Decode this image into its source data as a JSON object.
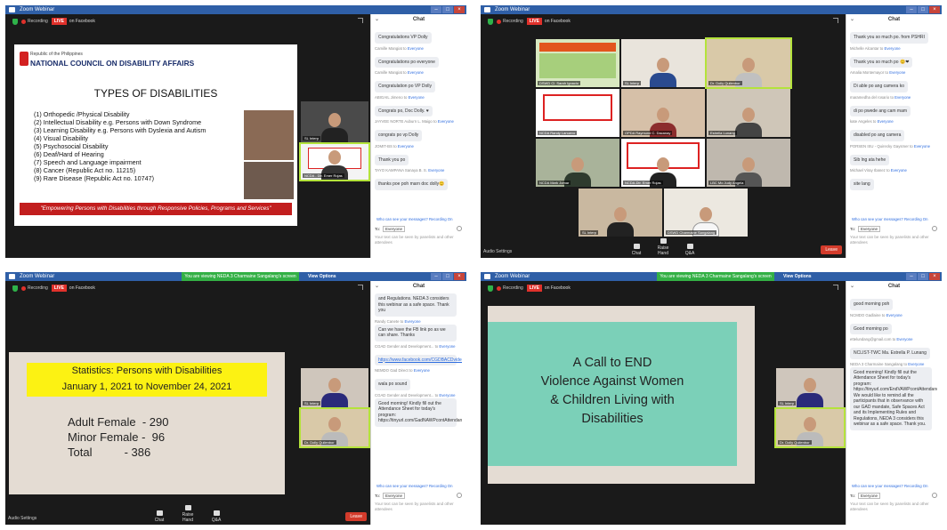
{
  "common": {
    "window_title": "Zoom Webinar",
    "recording": "Recording",
    "live": "LIVE",
    "on_facebook": "on Facebook",
    "chat_title": "Chat",
    "who_can_see": "Who can see your messages? Recording On",
    "to_label": "To:",
    "to_value": "Everyone",
    "chat_note": "Your text can be seen by panelists and other attendees",
    "audio_settings": "Audio Settings",
    "chat_btn": "Chat",
    "raise_hand": "Raise Hand",
    "qa": "Q&A",
    "leave": "Leave",
    "viewing": "You are viewing NEDA 3 Charmaine Sangalang's screen",
    "view_options": "View Options"
  },
  "q1": {
    "slide": {
      "republic": "Republic of the Philippines",
      "org": "NATIONAL COUNCIL ON DISABILITY AFFAIRS",
      "title": "TYPES OF DISABILITIES",
      "items": [
        "(1) Orthopedic /Physical Disability",
        "(2) Intellectual Disability e.g. Persons with Down Syndrome",
        "(3) Learning Disability e.g. Persons with Dyslexia and Autism",
        "(4) Visual Disability",
        "(5) Psychosocial Disability",
        "(6) Deaf/Hard of Hearing",
        "(7) Speech and Language impairment",
        "(8) Cancer (Republic Act no. 11215)",
        "(9) Rare Disease (Republic Act no. 10747)"
      ],
      "footer": "\"Empowering Persons with Disabilities through Responsive Policies, Programs and Services\""
    },
    "tiles": [
      {
        "name": "SL Interp"
      },
      {
        "name": "NCDA - Dir. Emer Rojas"
      }
    ],
    "messages": [
      {
        "from": "",
        "to": "",
        "text": "Congratulations VP Dolly"
      },
      {
        "from": "Camille Mangiat to",
        "to": "Everyone",
        "text": "Congratulations po everyone"
      },
      {
        "from": "Camille Mangiat to",
        "to": "Everyone",
        "text": "Congratulation po VP Dolly"
      },
      {
        "from": "ABIGAIL Jimeno to",
        "to": "Everyone",
        "text": "Congrats po, Doc Dolly. ♥"
      },
      {
        "from": "JAYVEE NORTE Auburn L. Maigo to",
        "to": "Everyone",
        "text": "congrats po vp Dolly"
      },
      {
        "from": "JOMIT-BS to",
        "to": "Everyone",
        "text": "Thank you po"
      },
      {
        "from": "TAYO KAMPANA Sanaya B. S.",
        "to": "Everyone",
        "text": "thanks poe poh marn doc dolly😊"
      }
    ]
  },
  "q2": {
    "tiles": [
      {
        "name": "DSWD Cl. Sarah Ignacio"
      },
      {
        "name": "SL Interp"
      },
      {
        "name": "Dr. Dolly Quilenbor"
      },
      {
        "name": "NCDA Randy Lanuevo"
      },
      {
        "name": "OPDA Raymund C. Dacanay"
      },
      {
        "name": "Estrella Lunang"
      },
      {
        "name": "NCDA Mark Jomar"
      },
      {
        "name": "NCDA-Dir. Emer Rojas"
      },
      {
        "name": "LBC Mo Judy Angela"
      },
      {
        "name": "SL Interp"
      },
      {
        "name": "DSWD Charmaine Sangalang"
      }
    ],
    "messages": [
      {
        "from": "",
        "to": "",
        "text": "Thank you so much po. from PSHRI"
      },
      {
        "from": "Michelle Alcantar to",
        "to": "Everyone",
        "text": "Thank you so much po 😊❤"
      },
      {
        "from": "Amalia Montemayor to",
        "to": "Everyone",
        "text": "Di able po ang camera ko"
      },
      {
        "from": "maramedha del rosario to",
        "to": "Everyone",
        "text": "di po pwede ang cam mam"
      },
      {
        "from": "kate Angeles to",
        "to": "Everyone",
        "text": "disabled po ang camera"
      },
      {
        "from": "PORSEN ISU - Quirecky Gaysmer to",
        "to": "Everyone",
        "text": "Sib lng ata hehe"
      },
      {
        "from": "Michael Viray Ibanez to",
        "to": "Everyone",
        "text": "site lang"
      }
    ]
  },
  "q3": {
    "slide": {
      "title_line1": "Statistics: Persons with Disabilities",
      "title_line2": "January 1, 2021 to November 24, 2021",
      "stat1": "Adult Female  - 290",
      "stat2": "Minor Female -  96",
      "stat3": "Total          - 386"
    },
    "tiles": [
      {
        "name": "SL Interp"
      },
      {
        "name": "Dr. Dolly Quilenbor"
      }
    ],
    "messages": [
      {
        "from": "",
        "to": "",
        "text": "and Regulations. NEDA 3 considers this webinar as a safe space. Thank you"
      },
      {
        "from": "Randy Canete to",
        "to": "Everyone",
        "text": "Can we have the FB link po as we can share. Thanks"
      },
      {
        "from": "CGAD Gender and Development... to",
        "to": "Everyone",
        "text": "https://www.facebook.com/CGDBACDvideos/27751469089338/",
        "link": true
      },
      {
        "from": "NEMDO Gad Direct to",
        "to": "Everyone",
        "text": "wala po sound"
      },
      {
        "from": "CGAD Gender and Development... to",
        "to": "Everyone",
        "text": "Good morning! Kindly fill out the Attendance Sheet for today's program: https://tinyurl.com/GadNAWPcontAttendance"
      }
    ]
  },
  "q4": {
    "slide": {
      "lines": [
        "A Call to END",
        "Violence Against Women",
        "& Children Living  with",
        "Disabilities"
      ]
    },
    "tiles": [
      {
        "name": "SL Interp"
      },
      {
        "name": "Dr. Dolly Quilenbor"
      }
    ],
    "messages": [
      {
        "from": "",
        "to": "",
        "text": "good morning poh"
      },
      {
        "from": "NCMDO Gadlaine to",
        "to": "Everyone",
        "text": "Good morning po"
      },
      {
        "from": "ettelundang@gmail.com to",
        "to": "Everyone",
        "text": "NCLIST-TWC Ma. Estrella P. Lunang"
      },
      {
        "from": "NEDA 3 Charmaine Sangalang to",
        "to": "Everyone",
        "text": "Good morning! Kindly fill out the Attendance Sheet for today's program: https://tinyurl.com/EndVAWPcontAttendance We would like to remind all the participants that in observance with our GAD mandate, Safe Spaces Act and its Implementing Rules and Regulations, NEDA 3 considers this webinar as a safe space. Thank you."
      }
    ]
  }
}
